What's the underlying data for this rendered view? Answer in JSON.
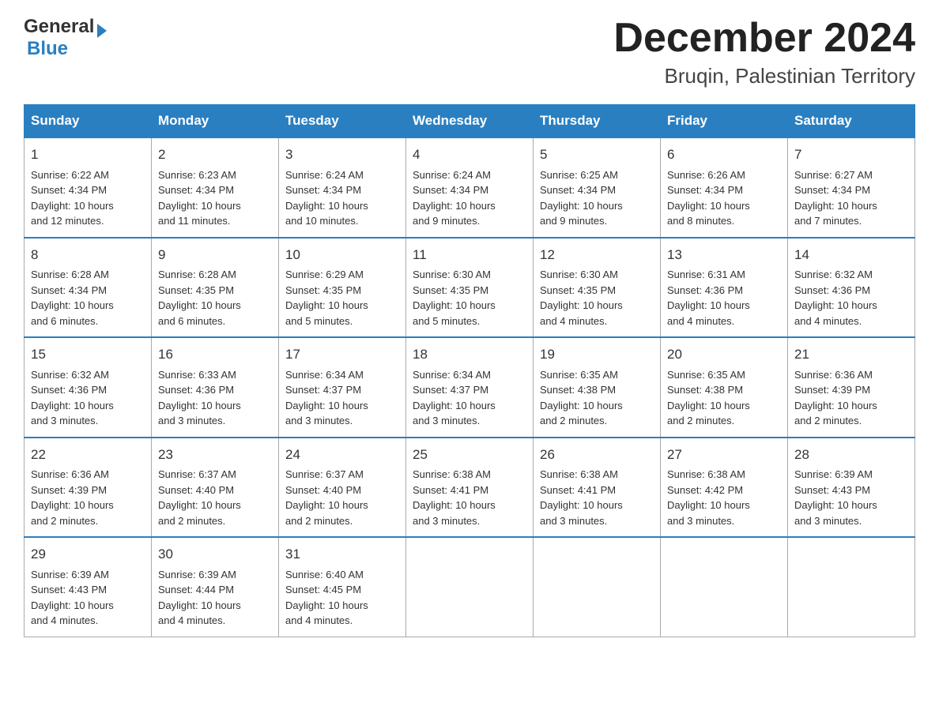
{
  "header": {
    "logo_general": "General",
    "logo_blue": "Blue",
    "title": "December 2024",
    "subtitle": "Bruqin, Palestinian Territory"
  },
  "days_of_week": [
    "Sunday",
    "Monday",
    "Tuesday",
    "Wednesday",
    "Thursday",
    "Friday",
    "Saturday"
  ],
  "weeks": [
    [
      {
        "day": "1",
        "info": "Sunrise: 6:22 AM\nSunset: 4:34 PM\nDaylight: 10 hours\nand 12 minutes."
      },
      {
        "day": "2",
        "info": "Sunrise: 6:23 AM\nSunset: 4:34 PM\nDaylight: 10 hours\nand 11 minutes."
      },
      {
        "day": "3",
        "info": "Sunrise: 6:24 AM\nSunset: 4:34 PM\nDaylight: 10 hours\nand 10 minutes."
      },
      {
        "day": "4",
        "info": "Sunrise: 6:24 AM\nSunset: 4:34 PM\nDaylight: 10 hours\nand 9 minutes."
      },
      {
        "day": "5",
        "info": "Sunrise: 6:25 AM\nSunset: 4:34 PM\nDaylight: 10 hours\nand 9 minutes."
      },
      {
        "day": "6",
        "info": "Sunrise: 6:26 AM\nSunset: 4:34 PM\nDaylight: 10 hours\nand 8 minutes."
      },
      {
        "day": "7",
        "info": "Sunrise: 6:27 AM\nSunset: 4:34 PM\nDaylight: 10 hours\nand 7 minutes."
      }
    ],
    [
      {
        "day": "8",
        "info": "Sunrise: 6:28 AM\nSunset: 4:34 PM\nDaylight: 10 hours\nand 6 minutes."
      },
      {
        "day": "9",
        "info": "Sunrise: 6:28 AM\nSunset: 4:35 PM\nDaylight: 10 hours\nand 6 minutes."
      },
      {
        "day": "10",
        "info": "Sunrise: 6:29 AM\nSunset: 4:35 PM\nDaylight: 10 hours\nand 5 minutes."
      },
      {
        "day": "11",
        "info": "Sunrise: 6:30 AM\nSunset: 4:35 PM\nDaylight: 10 hours\nand 5 minutes."
      },
      {
        "day": "12",
        "info": "Sunrise: 6:30 AM\nSunset: 4:35 PM\nDaylight: 10 hours\nand 4 minutes."
      },
      {
        "day": "13",
        "info": "Sunrise: 6:31 AM\nSunset: 4:36 PM\nDaylight: 10 hours\nand 4 minutes."
      },
      {
        "day": "14",
        "info": "Sunrise: 6:32 AM\nSunset: 4:36 PM\nDaylight: 10 hours\nand 4 minutes."
      }
    ],
    [
      {
        "day": "15",
        "info": "Sunrise: 6:32 AM\nSunset: 4:36 PM\nDaylight: 10 hours\nand 3 minutes."
      },
      {
        "day": "16",
        "info": "Sunrise: 6:33 AM\nSunset: 4:36 PM\nDaylight: 10 hours\nand 3 minutes."
      },
      {
        "day": "17",
        "info": "Sunrise: 6:34 AM\nSunset: 4:37 PM\nDaylight: 10 hours\nand 3 minutes."
      },
      {
        "day": "18",
        "info": "Sunrise: 6:34 AM\nSunset: 4:37 PM\nDaylight: 10 hours\nand 3 minutes."
      },
      {
        "day": "19",
        "info": "Sunrise: 6:35 AM\nSunset: 4:38 PM\nDaylight: 10 hours\nand 2 minutes."
      },
      {
        "day": "20",
        "info": "Sunrise: 6:35 AM\nSunset: 4:38 PM\nDaylight: 10 hours\nand 2 minutes."
      },
      {
        "day": "21",
        "info": "Sunrise: 6:36 AM\nSunset: 4:39 PM\nDaylight: 10 hours\nand 2 minutes."
      }
    ],
    [
      {
        "day": "22",
        "info": "Sunrise: 6:36 AM\nSunset: 4:39 PM\nDaylight: 10 hours\nand 2 minutes."
      },
      {
        "day": "23",
        "info": "Sunrise: 6:37 AM\nSunset: 4:40 PM\nDaylight: 10 hours\nand 2 minutes."
      },
      {
        "day": "24",
        "info": "Sunrise: 6:37 AM\nSunset: 4:40 PM\nDaylight: 10 hours\nand 2 minutes."
      },
      {
        "day": "25",
        "info": "Sunrise: 6:38 AM\nSunset: 4:41 PM\nDaylight: 10 hours\nand 3 minutes."
      },
      {
        "day": "26",
        "info": "Sunrise: 6:38 AM\nSunset: 4:41 PM\nDaylight: 10 hours\nand 3 minutes."
      },
      {
        "day": "27",
        "info": "Sunrise: 6:38 AM\nSunset: 4:42 PM\nDaylight: 10 hours\nand 3 minutes."
      },
      {
        "day": "28",
        "info": "Sunrise: 6:39 AM\nSunset: 4:43 PM\nDaylight: 10 hours\nand 3 minutes."
      }
    ],
    [
      {
        "day": "29",
        "info": "Sunrise: 6:39 AM\nSunset: 4:43 PM\nDaylight: 10 hours\nand 4 minutes."
      },
      {
        "day": "30",
        "info": "Sunrise: 6:39 AM\nSunset: 4:44 PM\nDaylight: 10 hours\nand 4 minutes."
      },
      {
        "day": "31",
        "info": "Sunrise: 6:40 AM\nSunset: 4:45 PM\nDaylight: 10 hours\nand 4 minutes."
      },
      {
        "day": "",
        "info": ""
      },
      {
        "day": "",
        "info": ""
      },
      {
        "day": "",
        "info": ""
      },
      {
        "day": "",
        "info": ""
      }
    ]
  ]
}
